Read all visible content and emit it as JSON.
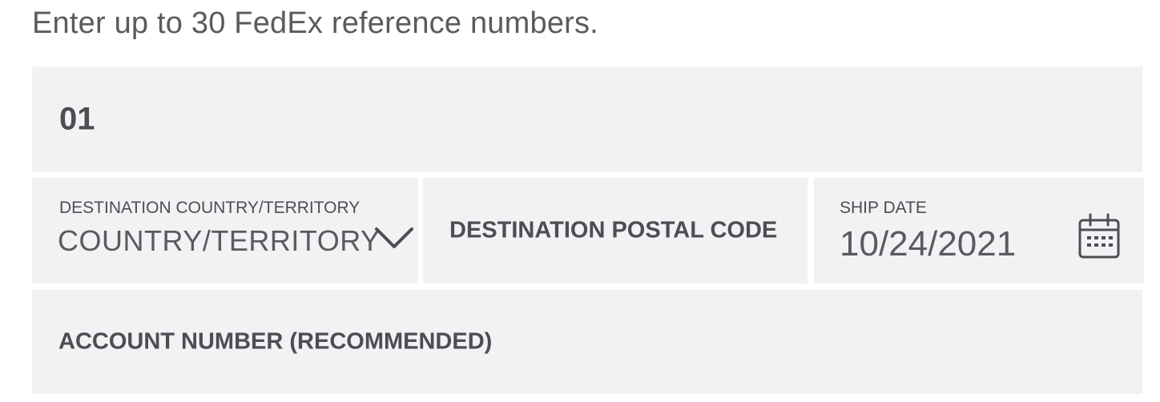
{
  "intro_text": "Enter up to 30 FedEx reference numbers.",
  "reference": {
    "value": "01"
  },
  "destination_country": {
    "label": "DESTINATION COUNTRY/TERRITORY",
    "value": "COUNTRY/TERRITORY",
    "icon": "chevron-down-icon"
  },
  "destination_postal": {
    "label": "DESTINATION POSTAL CODE"
  },
  "ship_date": {
    "label": "SHIP DATE",
    "value": "10/24/2021",
    "icon": "calendar-icon"
  },
  "account_number": {
    "label": "ACCOUNT NUMBER (RECOMMENDED)"
  },
  "colors": {
    "field_background": "#f2f2f5",
    "text_dark": "#4d4d52",
    "text_muted": "#5a5a5f"
  }
}
